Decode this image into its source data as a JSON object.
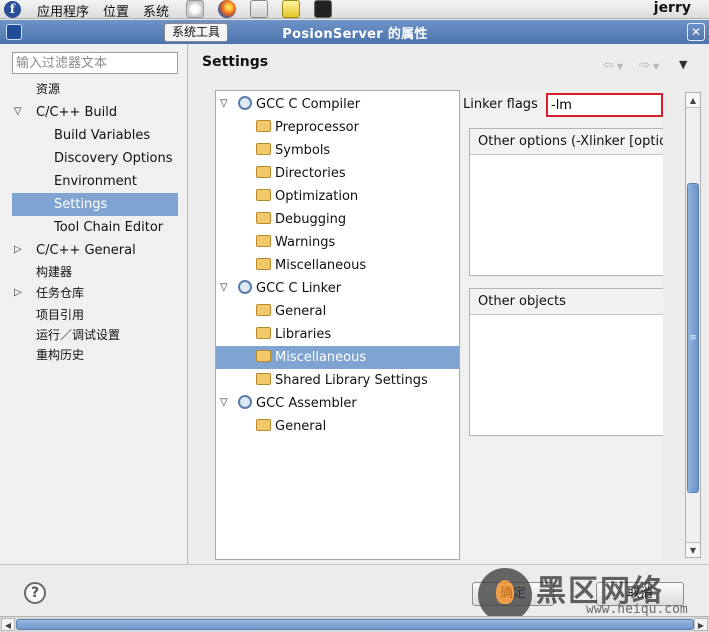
{
  "panel": {
    "menus": [
      "应用程序",
      "位置",
      "系统"
    ],
    "user": "jerry",
    "fedora_glyph": "f"
  },
  "window": {
    "tool_tab": "系统工具",
    "title": "PosionServer 的属性",
    "close_glyph": "✕"
  },
  "filter": {
    "placeholder": "输入过滤器文本"
  },
  "nav": {
    "items": [
      {
        "label": "资源",
        "depth": 0,
        "arrow": ""
      },
      {
        "label": "C/C++ Build",
        "depth": 0,
        "arrow": "▽"
      },
      {
        "label": "Build Variables",
        "depth": 1,
        "arrow": ""
      },
      {
        "label": "Discovery Options",
        "depth": 1,
        "arrow": ""
      },
      {
        "label": "Environment",
        "depth": 1,
        "arrow": ""
      },
      {
        "label": "Settings",
        "depth": 1,
        "arrow": "",
        "selected": true
      },
      {
        "label": "Tool Chain Editor",
        "depth": 1,
        "arrow": ""
      },
      {
        "label": "C/C++ General",
        "depth": 0,
        "arrow": "▷"
      },
      {
        "label": "构建器",
        "depth": 0,
        "arrow": ""
      },
      {
        "label": "任务仓库",
        "depth": 0,
        "arrow": "▷"
      },
      {
        "label": "项目引用",
        "depth": 0,
        "arrow": ""
      },
      {
        "label": "运行／调试设置",
        "depth": 0,
        "arrow": ""
      },
      {
        "label": "重构历史",
        "depth": 0,
        "arrow": ""
      }
    ]
  },
  "main": {
    "heading": "Settings",
    "back_glyph": "⇦",
    "forward_glyph": "⇨",
    "menu_glyph": "▼"
  },
  "tool_tree": [
    {
      "label": "GCC C Compiler",
      "kind": "tool"
    },
    {
      "label": "Preprocessor",
      "kind": "option"
    },
    {
      "label": "Symbols",
      "kind": "option"
    },
    {
      "label": "Directories",
      "kind": "option"
    },
    {
      "label": "Optimization",
      "kind": "option"
    },
    {
      "label": "Debugging",
      "kind": "option"
    },
    {
      "label": "Warnings",
      "kind": "option"
    },
    {
      "label": "Miscellaneous",
      "kind": "option"
    },
    {
      "label": "GCC C Linker",
      "kind": "tool"
    },
    {
      "label": "General",
      "kind": "option"
    },
    {
      "label": "Libraries",
      "kind": "option"
    },
    {
      "label": "Miscellaneous",
      "kind": "option",
      "selected": true
    },
    {
      "label": "Shared Library Settings",
      "kind": "option"
    },
    {
      "label": "GCC Assembler",
      "kind": "tool"
    },
    {
      "label": "General",
      "kind": "option"
    }
  ],
  "linker": {
    "flags_label": "Linker flags",
    "flags_value": "-lm",
    "other_options_header": "Other options (-Xlinker [option])",
    "other_objects_header": "Other objects"
  },
  "buttons": {
    "help_glyph": "?",
    "ok": "确定",
    "cancel": "取消"
  },
  "watermark": {
    "text": "黑区网络",
    "url": "www.heiqu.com"
  },
  "colors": {
    "selection": "#7fa4d1",
    "titlebar": "#5a7fb8",
    "highlight_border": "#d41f2a"
  }
}
